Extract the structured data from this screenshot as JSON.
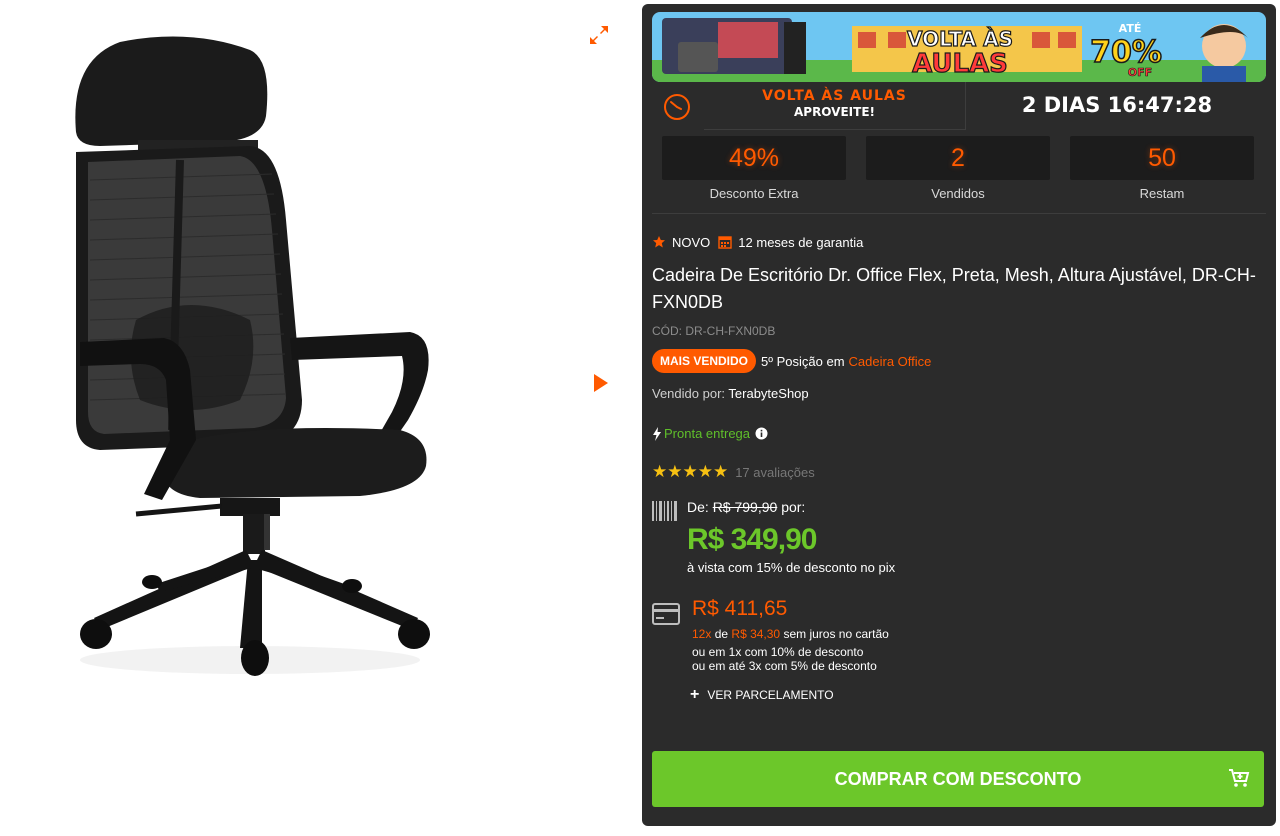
{
  "banner": {
    "line1": "VOLTA ÀS",
    "line2": "AULAS",
    "promo_prefix": "ATÉ",
    "promo_value": "70%",
    "promo_suffix": "OFF"
  },
  "countdown": {
    "title": "VOLTA ÀS AULAS",
    "subtitle": "APROVEITE!",
    "time": "2 DIAS 16:47:28"
  },
  "stats": [
    {
      "value": "49%",
      "label": "Desconto Extra"
    },
    {
      "value": "2",
      "label": "Vendidos"
    },
    {
      "value": "50",
      "label": "Restam"
    }
  ],
  "badges": {
    "condition": "NOVO",
    "warranty": "12 meses de garantia"
  },
  "product": {
    "title": "Cadeira De Escritório Dr. Office Flex, Preta, Mesh, Altura Ajustável, DR-CH-FXN0DB",
    "sku": "CÓD: DR-CH-FXN0DB",
    "bestseller_label": "MAIS VENDIDO",
    "ranking_text": "5º Posição em",
    "category": "Cadeira Office",
    "seller_prefix": "Vendido por:",
    "seller": "TerabyteShop",
    "availability": "Pronta entrega",
    "stars": "★★★★★",
    "reviews": "17 avaliações"
  },
  "pricing": {
    "from_label": "De:",
    "old_price": "R$ 799,90",
    "for_label": "por:",
    "pix_price": "R$ 349,90",
    "pix_note": "à vista com 15% de desconto no pix",
    "card_price": "R$ 411,65",
    "installments_count": "12x",
    "installments_of": "de",
    "installment_value": "R$ 34,30",
    "installments_note": "sem juros no cartão",
    "card_option_1": "ou em 1x com 10% de desconto",
    "card_option_2": "ou em até 3x com 5% de desconto",
    "see_installments": "VER PARCELAMENTO"
  },
  "cta": {
    "buy_label": "COMPRAR COM DESCONTO"
  },
  "colors": {
    "accent_orange": "#ff5a00",
    "price_green": "#6cc72a",
    "panel_bg": "#2b2b2b"
  },
  "icons": [
    "expand-icon",
    "next-arrow-icon",
    "clock-icon",
    "star-icon",
    "calendar-icon",
    "lightning-icon",
    "info-icon",
    "barcode-icon",
    "credit-card-icon",
    "plus-icon",
    "cart-icon"
  ]
}
